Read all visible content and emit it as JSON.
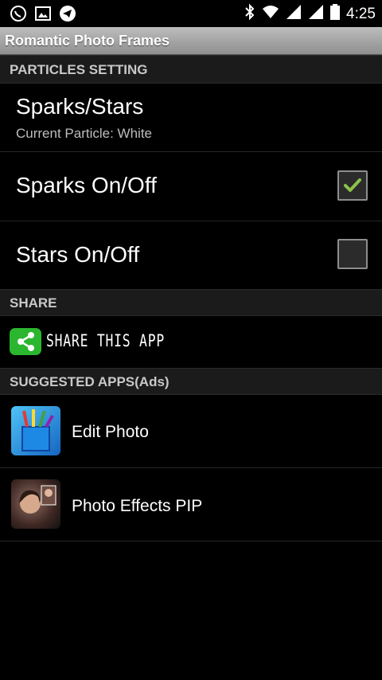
{
  "status_bar": {
    "time": "4:25"
  },
  "app": {
    "title": "Romantic Photo Frames"
  },
  "sections": {
    "particles": "PARTICLES SETTING",
    "share": "SHARE",
    "suggested": "SUGGESTED APPS(Ads)"
  },
  "sparks_stars": {
    "title": "Sparks/Stars",
    "subtitle": "Current Particle:  White"
  },
  "sparks_toggle": {
    "label": "Sparks On/Off",
    "checked": true
  },
  "stars_toggle": {
    "label": "Stars On/Off",
    "checked": false
  },
  "share": {
    "label": "SHARE THIS APP",
    "icon": "share-icon"
  },
  "apps": [
    {
      "label": "Edit Photo",
      "icon": "edit-photo-app-icon"
    },
    {
      "label": "Photo Effects PIP",
      "icon": "photo-effects-pip-app-icon"
    }
  ],
  "colors": {
    "check": "#8bc34a",
    "share": "#2bb62f"
  }
}
